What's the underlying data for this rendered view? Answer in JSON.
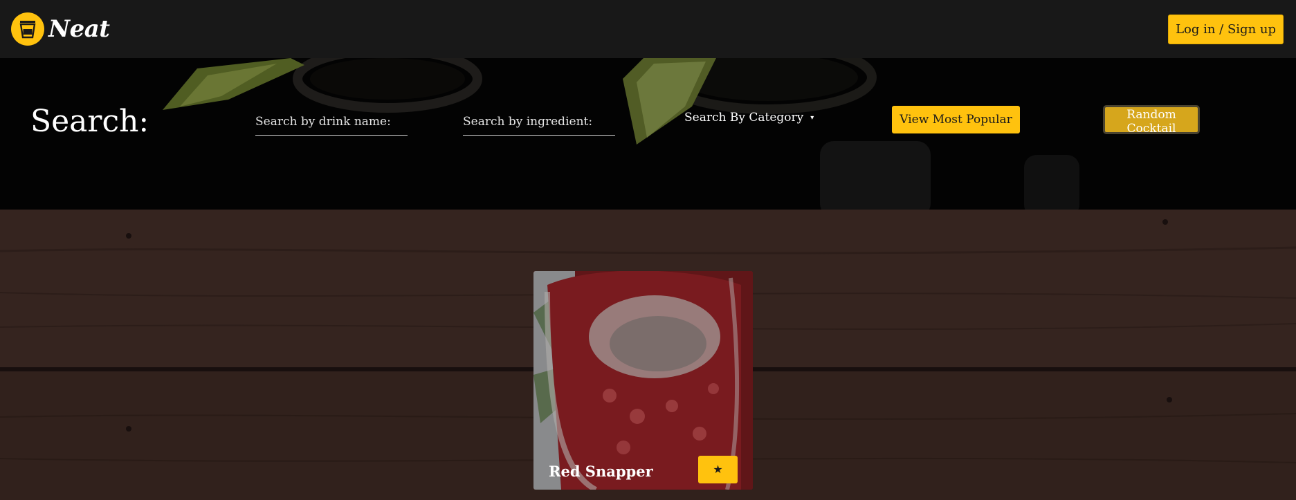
{
  "nav": {
    "brand_name": "Neat",
    "login_label": "Log in / Sign up"
  },
  "search": {
    "title": "Search:",
    "drink_name_placeholder": "Search by drink name:",
    "ingredient_placeholder": "Search by ingredient:",
    "category_label": "Search By Category",
    "category_caret": "▾",
    "popular_label": "View Most Popular",
    "random_label": "Random Cocktail"
  },
  "results": [
    {
      "name": "Red Snapper",
      "favorite_icon": "★"
    }
  ],
  "colors": {
    "accent": "#ffc20e",
    "nav_bg": "#181818",
    "hero_bg": "#070707",
    "wood": "#3a2822"
  }
}
